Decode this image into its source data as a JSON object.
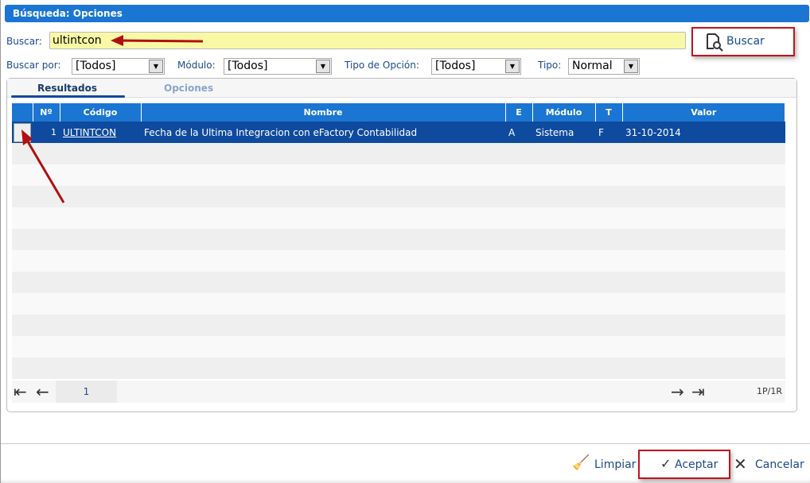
{
  "title": "Búsqueda: Opciones",
  "search": {
    "label": "Buscar:",
    "value": "ultintcon",
    "button": "Buscar"
  },
  "filters": [
    {
      "label": "Buscar por:",
      "value": "[Todos]"
    },
    {
      "label": "Módulo:",
      "value": "[Todos]"
    },
    {
      "label": "Tipo de Opción:",
      "value": "[Todos]"
    },
    {
      "label": "Tipo:",
      "value": "Normal"
    }
  ],
  "tabs": [
    "Resultados",
    "Opciones"
  ],
  "table": {
    "headers": [
      "",
      "Nº",
      "Código",
      "Nombre",
      "E",
      "Módulo",
      "T",
      "Valor"
    ],
    "rows": [
      {
        "num": "1",
        "codigo": "ULTINTCON",
        "nombre": "Fecha de la Ultima Integracion con eFactory Contabilidad",
        "e": "A",
        "modulo": "Sistema",
        "t": "F",
        "valor": "31-10-2014"
      }
    ]
  },
  "pager": {
    "page": "1",
    "info": "1P/1R"
  },
  "footer": {
    "limpiar": "Limpiar",
    "aceptar": "Aceptar",
    "cancelar": "Cancelar"
  }
}
